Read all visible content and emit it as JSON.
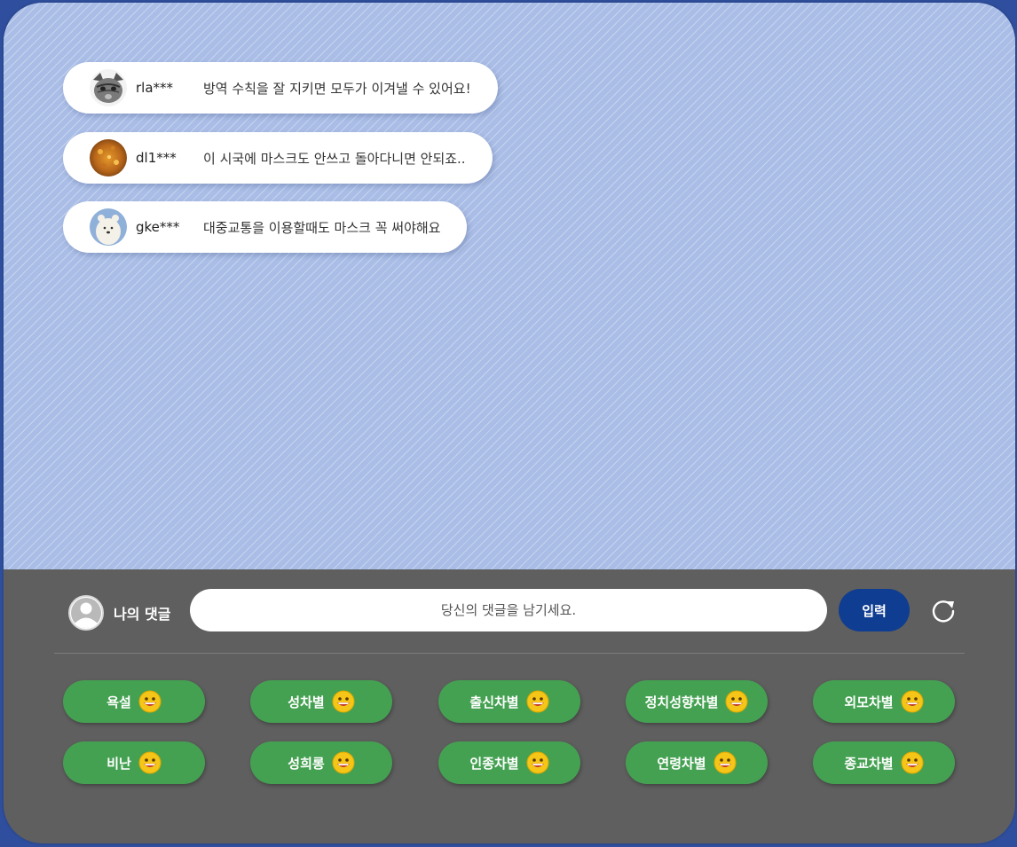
{
  "comments": [
    {
      "user": "rla***",
      "text": "방역 수칙을 잘 지키면 모두가 이겨낼 수 있어요!",
      "avatar": "cat-avatar-icon"
    },
    {
      "user": "dl1***",
      "text": "이 시국에 마스크도 안쓰고 돌아다니면 안되죠..",
      "avatar": "orange-texture-avatar-icon"
    },
    {
      "user": "gke***",
      "text": "대중교통을 이용할때도 마스크 꼭 써야해요",
      "avatar": "polar-bear-avatar-icon"
    }
  ],
  "composer": {
    "my_label": "나의 댓글",
    "placeholder": "당신의 댓글을 남기세요.",
    "submit_label": "입력"
  },
  "tags": [
    {
      "label": "욕설"
    },
    {
      "label": "성차별"
    },
    {
      "label": "출신차별"
    },
    {
      "label": "정치성향차별"
    },
    {
      "label": "외모차별"
    },
    {
      "label": "비난"
    },
    {
      "label": "성희롱"
    },
    {
      "label": "인종차별"
    },
    {
      "label": "연령차별"
    },
    {
      "label": "종교차별"
    }
  ],
  "colors": {
    "chat_background": "#a9bde6",
    "bottom_background": "#5f5f5f",
    "submit_button": "#0f3d91",
    "tag_button": "#45a152",
    "emoji_face": "#f5c518"
  }
}
